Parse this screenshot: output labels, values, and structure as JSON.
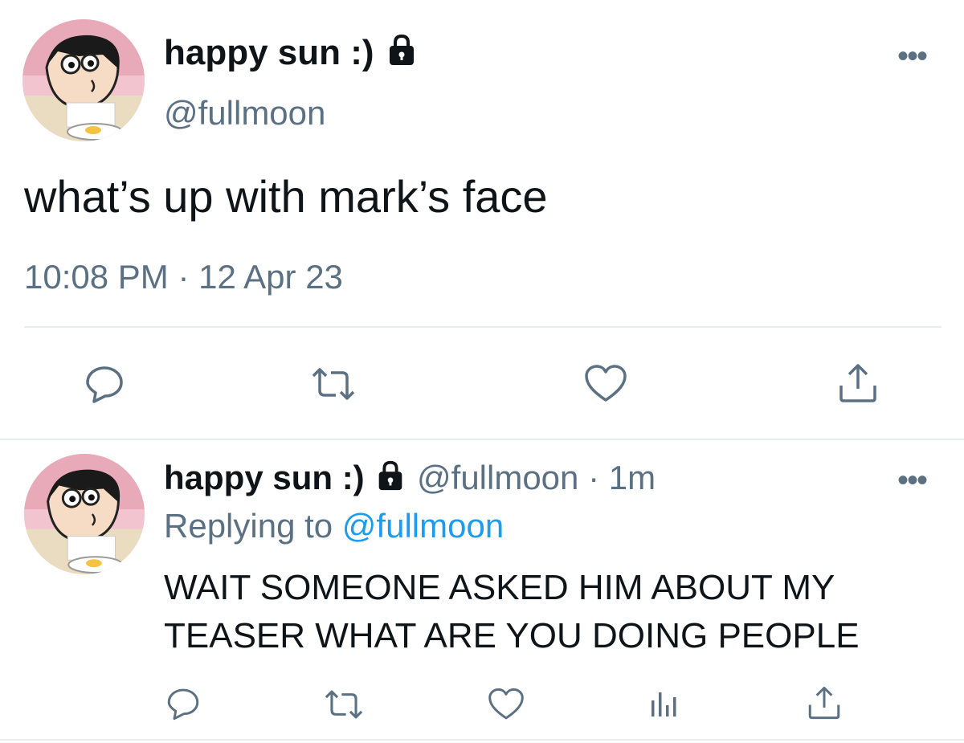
{
  "main_tweet": {
    "display_name": "happy sun :)",
    "handle": "@fullmoon",
    "text": "what’s up with mark’s face",
    "timestamp": "10:08 PM · 12 Apr 23",
    "icons": [
      "reply-icon",
      "retweet-icon",
      "like-icon",
      "share-icon"
    ]
  },
  "reply_tweet": {
    "display_name": "happy sun :)",
    "handle": "@fullmoon",
    "time": "· 1m",
    "replying_prefix": "Replying to",
    "replying_to": "@fullmoon",
    "text_line1": "WAIT SOMEONE ASKED HIM ABOUT MY",
    "text_line2": "TEASER WHAT ARE YOU DOING PEOPLE",
    "icons": [
      "reply-icon",
      "retweet-icon",
      "like-icon",
      "analytics-icon",
      "share-icon"
    ]
  },
  "more_label": "•••",
  "colors": {
    "text": "#0f1419",
    "muted": "#5b7083",
    "link": "#1d9bf0",
    "divider": "#e6ecf0"
  }
}
